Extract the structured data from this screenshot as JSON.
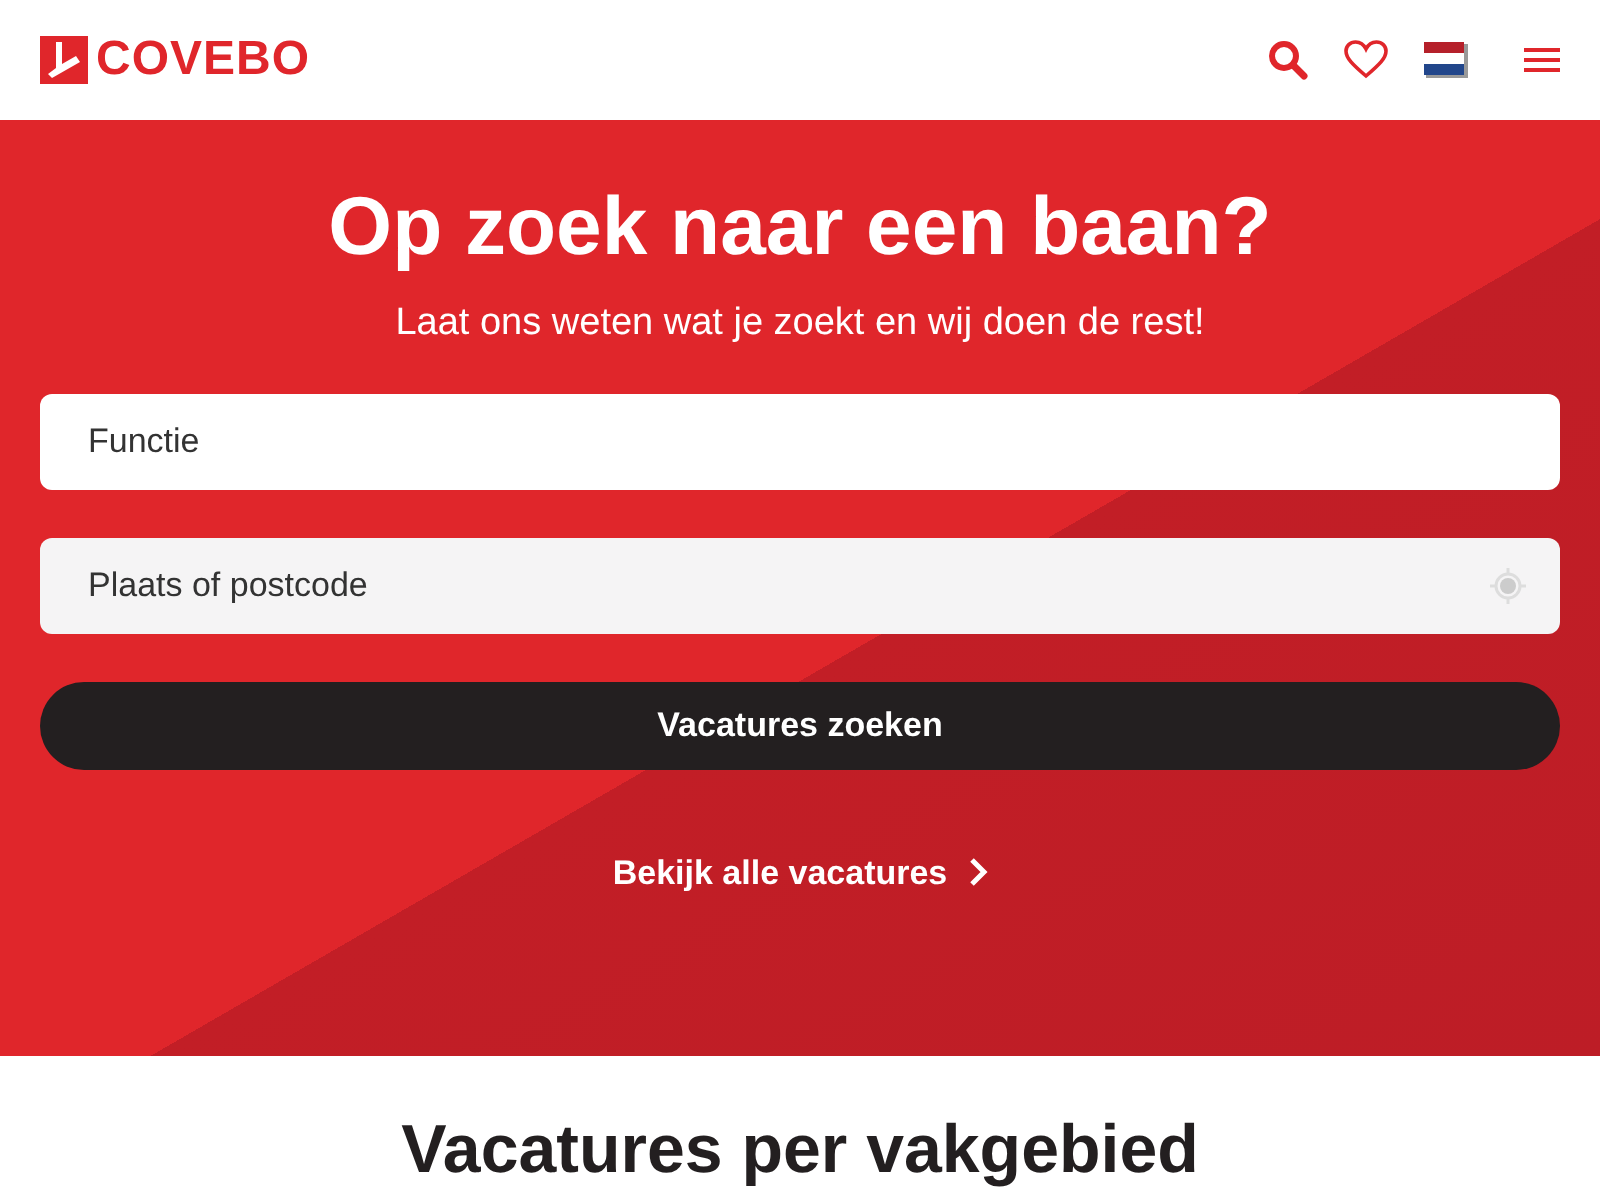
{
  "header": {
    "logo": "COVEBO"
  },
  "hero": {
    "title": "Op zoek naar een baan?",
    "subtitle": "Laat ons weten wat je zoekt en wij doen de rest!",
    "fields": [
      {
        "placeholder": "Functie",
        "kind": "plain"
      },
      {
        "placeholder": "Plaats of postcode",
        "kind": "location"
      }
    ],
    "search_button": "Vacatures zoeken",
    "all_link": "Bekijk alle vacatures"
  },
  "section": {
    "title": "Vacatures per vakgebied"
  }
}
